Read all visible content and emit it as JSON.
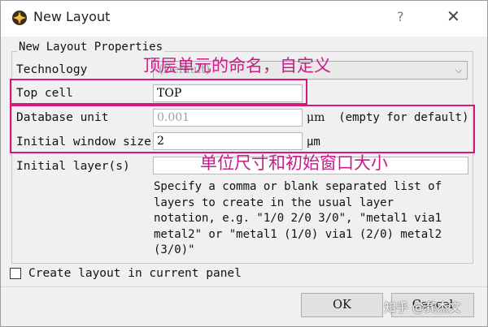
{
  "window": {
    "title": "New Layout",
    "help": "?",
    "close": "✕"
  },
  "group": {
    "title": "New Layout Properties"
  },
  "technology": {
    "label": "Technology",
    "value": "(Default)"
  },
  "top_cell": {
    "label": "Top cell",
    "value": "TOP"
  },
  "database_unit": {
    "label": "Database unit",
    "placeholder": "0.001",
    "unit_symbol": "μm",
    "unit_note": "(empty for default)"
  },
  "initial_window_size": {
    "label": "Initial window size",
    "value": "2",
    "unit_symbol": "μm"
  },
  "initial_layers": {
    "label": "Initial layer(s)",
    "value": "",
    "hint_lines": [
      "Specify a comma or blank separated list of",
      "layers to create in the usual layer",
      "notation, e.g. \"1/0 2/0 3/0\", \"metal1 via1",
      "metal2\" or \"metal1 (1/0) via1 (2/0) metal2",
      "(3/0)\""
    ]
  },
  "create_in_current_panel": {
    "label": "Create layout in current panel",
    "checked": false
  },
  "buttons": {
    "ok": "OK",
    "cancel": "Cancel"
  },
  "annotations": {
    "top_cell_note": "顶层单元的命名，自定义",
    "unit_note": "单位尺寸和初始窗口大小"
  },
  "watermark": "知乎 @龚杰文",
  "colors": {
    "highlight": "#d41a78",
    "annotation": "#c71e89"
  }
}
